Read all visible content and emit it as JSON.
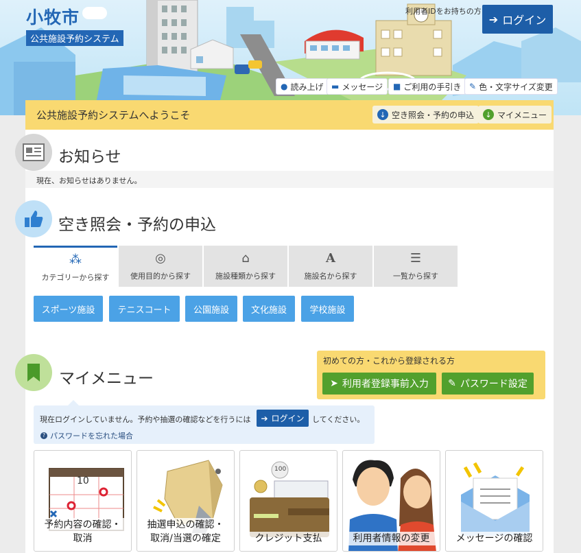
{
  "header": {
    "city_title": "小牧市",
    "system_badge": "公共施設予約システム",
    "login_hint": "利用者IDをお持ちの方",
    "login_label": "ログイン",
    "tools": [
      {
        "label": "読み上げ",
        "icon": "microphone-icon"
      },
      {
        "label": "メッセージ",
        "icon": "speech-bubble-icon"
      },
      {
        "label": "ご利用の手引き",
        "icon": "book-icon"
      },
      {
        "label": "色・文字サイズ変更",
        "icon": "brush-icon"
      }
    ]
  },
  "welcome": {
    "text": "公共施設予約システムへようこそ",
    "jump_reserve": "空き照会・予約の申込",
    "jump_mymenu": "マイメニュー"
  },
  "notice": {
    "title": "お知らせ",
    "message": "現在、お知らせはありません。"
  },
  "reserve": {
    "title": "空き照会・予約の申込",
    "tabs": [
      {
        "label": "カテゴリーから探す",
        "icon": "share-icon"
      },
      {
        "label": "使用目的から探す",
        "icon": "compass-icon"
      },
      {
        "label": "施設種類から探す",
        "icon": "building-icon"
      },
      {
        "label": "施設名から探す",
        "icon": "font-icon"
      },
      {
        "label": "一覧から探す",
        "icon": "list-icon"
      }
    ],
    "categories": [
      "スポーツ施設",
      "テニスコート",
      "公園施設",
      "文化施設",
      "学校施設"
    ]
  },
  "mymenu": {
    "title": "マイメニュー",
    "register_title": "初めての方・これから登録される方",
    "register_button": "利用者登録事前入力",
    "password_button": "パスワード設定",
    "login_info_before": "現在ログインしていません。予約や抽選の確認などを行うには",
    "login_info_button": "ログイン",
    "login_info_after": "してください。",
    "forgot_password": "パスワードを忘れた場合",
    "cards": [
      {
        "line1": "予約内容の確認・",
        "line2": "取消"
      },
      {
        "line1": "抽選申込の確認・",
        "line2": "取消/当選の確定"
      },
      {
        "line1": "クレジット支払",
        "line2": ""
      },
      {
        "line1": "利用者情報の変更",
        "line2": ""
      },
      {
        "line1": "メッセージの確認",
        "line2": ""
      }
    ],
    "calendar_number": "10",
    "coin_label": "100"
  },
  "colors": {
    "brand_blue": "#2367b5",
    "category_blue": "#4ba2e6",
    "green": "#52a02d",
    "yellow": "#f9d971"
  }
}
